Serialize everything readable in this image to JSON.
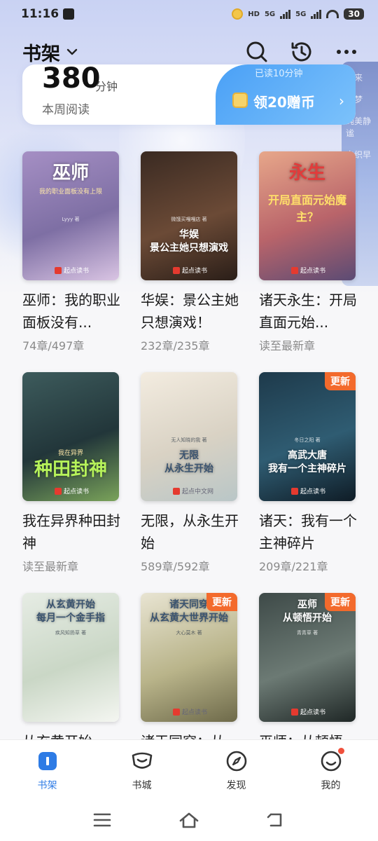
{
  "status_bar": {
    "time": "11:16",
    "badges": [
      "HD",
      "5G",
      "5G"
    ],
    "battery": "30"
  },
  "background": {
    "banner_texts": [
      "晚来",
      "幽梦",
      "纯美静谧",
      "白织早"
    ]
  },
  "header": {
    "title": "书架",
    "icons": [
      "chevron-down-icon",
      "search-icon",
      "history-icon",
      "more-icon"
    ]
  },
  "reading_stats": {
    "minutes": "380",
    "unit": "分钟",
    "label": "本周阅读",
    "reward_top_text": "已读10分钟",
    "reward_label": "领20赠币",
    "reward_arrow": "›"
  },
  "books": [
    {
      "title": "巫师：我的职业面板没有...",
      "progress": "74章/497章",
      "cover_title": "巫师",
      "cover_sub": "我的职业面板没有上限",
      "cover_author": "Lyyy 著",
      "brand": "起点读书",
      "update": "",
      "colors": [
        "#a58fc4",
        "#7e6fa4",
        "#d9c4e3"
      ]
    },
    {
      "title": "华娱：景公主她只想演戏！",
      "progress": "232章/235章",
      "cover_title": "华娱\n景公主她只想演戏",
      "cover_sub": "",
      "cover_author": "微饿买嘎嘎店 著",
      "brand": "起点读书",
      "update": "",
      "colors": [
        "#3a2a22",
        "#6b4a36",
        "#2a1e18"
      ]
    },
    {
      "title": "诸天永生：开局直面元始...",
      "progress": "读至最新章",
      "cover_title": "永生",
      "cover_sub": "开局直面元始魔主？",
      "cover_author": "",
      "brand": "起点读书",
      "update": "",
      "colors": [
        "#e7a78a",
        "#b9646a",
        "#5b4b74"
      ]
    },
    {
      "title": "我在异界种田封神",
      "progress": "读至最新章",
      "cover_title": "种田封神",
      "cover_sub": "我在异界",
      "cover_author": "",
      "brand": "起点读书",
      "update": "",
      "colors": [
        "#3d5b5c",
        "#22363a",
        "#7aa35a"
      ]
    },
    {
      "title": "无限，从永生开始",
      "progress": "589章/592章",
      "cover_title": "无限\n从永生开始",
      "cover_sub": "",
      "cover_author": "无人知晓的我 著",
      "brand": "起点中文网",
      "update": "",
      "colors": [
        "#f3ece0",
        "#d9d2c4",
        "#b9c6c7"
      ]
    },
    {
      "title": "诸天：我有一个主神碎片",
      "progress": "209章/221章",
      "cover_title": "高武大唐\n我有一个主神碎片",
      "cover_sub": "",
      "cover_author": "冬日之阳 著",
      "brand": "起点读书",
      "update": "更新",
      "colors": [
        "#1e3a4b",
        "#2f5c72",
        "#0f1c26"
      ]
    },
    {
      "title": "从玄黄开始",
      "progress": "",
      "cover_title": "从玄黄开始\n每月一个金手指",
      "cover_sub": "",
      "cover_author": "疾风知扬草 著",
      "brand": "",
      "update": "",
      "colors": [
        "#e6ece4",
        "#cad7c6",
        "#f4f6f1"
      ]
    },
    {
      "title": "诸天同穿：从",
      "progress": "",
      "cover_title": "诸天同穿\n从玄黄大世界开始",
      "cover_sub": "",
      "cover_author": "大心莫木 著",
      "brand": "起点读书",
      "update": "更新",
      "colors": [
        "#e8e4d2",
        "#b9b48a",
        "#6e6a4a"
      ]
    },
    {
      "title": "巫师：从顿悟",
      "progress": "",
      "cover_title": "巫师\n从顿悟开始",
      "cover_sub": "",
      "cover_author": "青青草 著",
      "brand": "起点读书",
      "update": "更新",
      "colors": [
        "#3e4a48",
        "#6c7a74",
        "#1f2726"
      ]
    }
  ],
  "bottom_nav": [
    {
      "label": "书架",
      "icon": "bookshelf-icon",
      "active": true
    },
    {
      "label": "书城",
      "icon": "bookstore-icon",
      "active": false
    },
    {
      "label": "发现",
      "icon": "discover-icon",
      "active": false
    },
    {
      "label": "我的",
      "icon": "profile-icon",
      "active": false,
      "dot": true
    }
  ],
  "system_nav": [
    "menu-icon",
    "home-icon",
    "back-icon"
  ],
  "colors": {
    "accent": "#2d7be5",
    "update_tag": "#f36a2c",
    "reward_gradient_start": "#4aa0f6",
    "reward_gradient_end": "#7cc2fb"
  }
}
